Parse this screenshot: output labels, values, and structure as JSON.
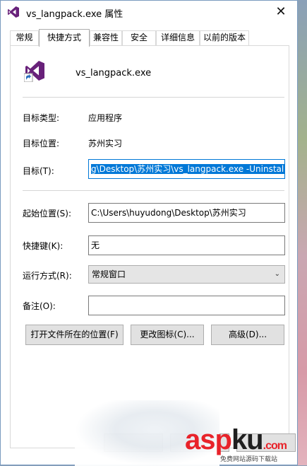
{
  "window": {
    "title": "vs_langpack.exe 属性",
    "close_symbol": "✕"
  },
  "tabs": [
    {
      "label": "常规",
      "active": false
    },
    {
      "label": "快捷方式",
      "active": true
    },
    {
      "label": "兼容性",
      "active": false
    },
    {
      "label": "安全",
      "active": false
    },
    {
      "label": "详细信息",
      "active": false
    },
    {
      "label": "以前的版本",
      "active": false
    }
  ],
  "header": {
    "app_name": "vs_langpack.exe",
    "icon": "visual-studio-shortcut-icon"
  },
  "info": {
    "target_type_label": "目标类型:",
    "target_type_value": "应用程序",
    "target_location_label": "目标位置:",
    "target_location_value": "苏州实习",
    "target_label": "目标(T):",
    "target_value": "g\\Desktop\\苏州实习\\vs_langpack.exe -Uninstall"
  },
  "fields": {
    "start_in_label": "起始位置(S):",
    "start_in_value": "C:\\Users\\huyudong\\Desktop\\苏州实习",
    "shortcut_key_label": "快捷键(K):",
    "shortcut_key_value": "无",
    "run_label": "运行方式(R):",
    "run_value": "常规窗口",
    "comment_label": "备注(O):",
    "comment_value": ""
  },
  "buttons": {
    "open_location": "打开文件所在的位置(F)",
    "change_icon": "更改图标(C)...",
    "advanced": "高级(D)..."
  },
  "watermark": {
    "logo_part1": "asp",
    "logo_part2": "ku",
    "logo_part3": ".com",
    "subtitle": "免费网站源码下载站"
  },
  "colors": {
    "accent": "#0078d7",
    "vs_purple": "#68217a",
    "watermark_red": "#e8232a"
  }
}
